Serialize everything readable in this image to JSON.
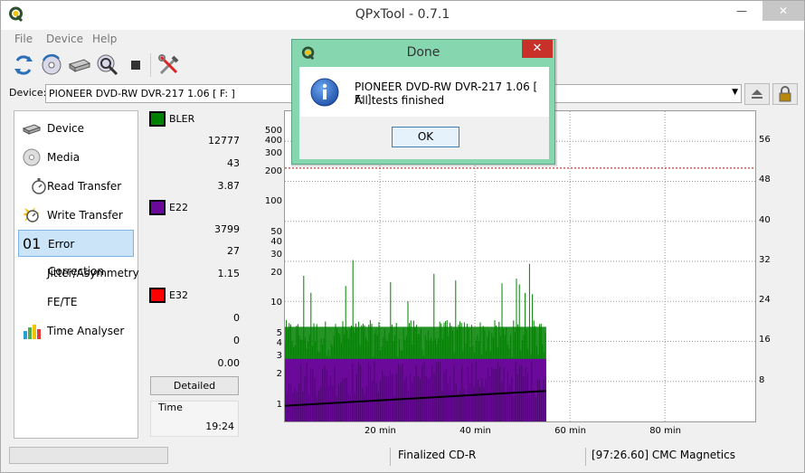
{
  "window": {
    "title": "QPxTool - 0.7.1"
  },
  "menu": [
    "File",
    "Device",
    "Help"
  ],
  "device": {
    "label": "Device:",
    "selected": "PIONEER  DVD-RW  DVR-217  1.06 [ F: ]"
  },
  "sidebar": {
    "items": [
      {
        "label": "Device",
        "icon": "drive-icon"
      },
      {
        "label": "Media",
        "icon": "disc-icon"
      },
      {
        "label": "Read Transfer",
        "icon": "stopwatch-icon"
      },
      {
        "label": "Write Transfer",
        "icon": "stopwatch-burst-icon"
      },
      {
        "label": "Error Correction",
        "icon": "error-counter-icon",
        "prefix": "01"
      },
      {
        "label": "Jitter/Asymmetry",
        "icon": ""
      },
      {
        "label": "FE/TE",
        "icon": ""
      },
      {
        "label": "Time Analyser",
        "icon": "bar-chart-icon"
      }
    ],
    "active_index": 4
  },
  "legend": {
    "groups": [
      {
        "name": "BLER",
        "color": "#008000",
        "values": [
          "12777",
          "43",
          "3.87"
        ]
      },
      {
        "name": "E22",
        "color": "#6b0a9a",
        "values": [
          "3799",
          "27",
          "1.15"
        ]
      },
      {
        "name": "E32",
        "color": "#ff0000",
        "values": [
          "0",
          "0",
          "0.00"
        ]
      }
    ],
    "detailed_label": "Detailed",
    "time_label": "Time",
    "time_value": "19:24"
  },
  "chart_data": {
    "type": "bar",
    "x_tick_labels": [
      "20 min",
      "40 min",
      "60 min",
      "80 min"
    ],
    "x_ticks": [
      20,
      40,
      60,
      80
    ],
    "xlim": [
      0,
      99
    ],
    "y_left_ticks": [
      1,
      2,
      3,
      4,
      5,
      10,
      20,
      30,
      40,
      50,
      100,
      200,
      300,
      400,
      500
    ],
    "ylim_left": [
      0.7,
      800
    ],
    "y_scale": "log",
    "y_right_ticks": [
      8,
      16,
      24,
      32,
      40,
      48,
      56
    ],
    "ylim_right": [
      0,
      62
    ],
    "threshold_value": 220,
    "threshold_color": "#cc0000",
    "data_end_minute": 55,
    "bler_peak_max": 40,
    "e22_peak_max": 2.8,
    "speed_start": 1.0,
    "speed_end": 1.4,
    "series_colors": {
      "bler": "#008000",
      "e22": "#6b0a9a",
      "speed": "#000000"
    },
    "grid": true
  },
  "status": {
    "progress": 0,
    "media_type": "Finalized CD-R",
    "media_info": "[97:26.60] CMC Magnetics"
  },
  "dialog": {
    "title": "Done",
    "close_label": "✕",
    "message_line1": "PIONEER  DVD-RW  DVR-217  1.06 [ F: ]:",
    "message_line2": "All tests finished",
    "ok_label": "OK"
  }
}
